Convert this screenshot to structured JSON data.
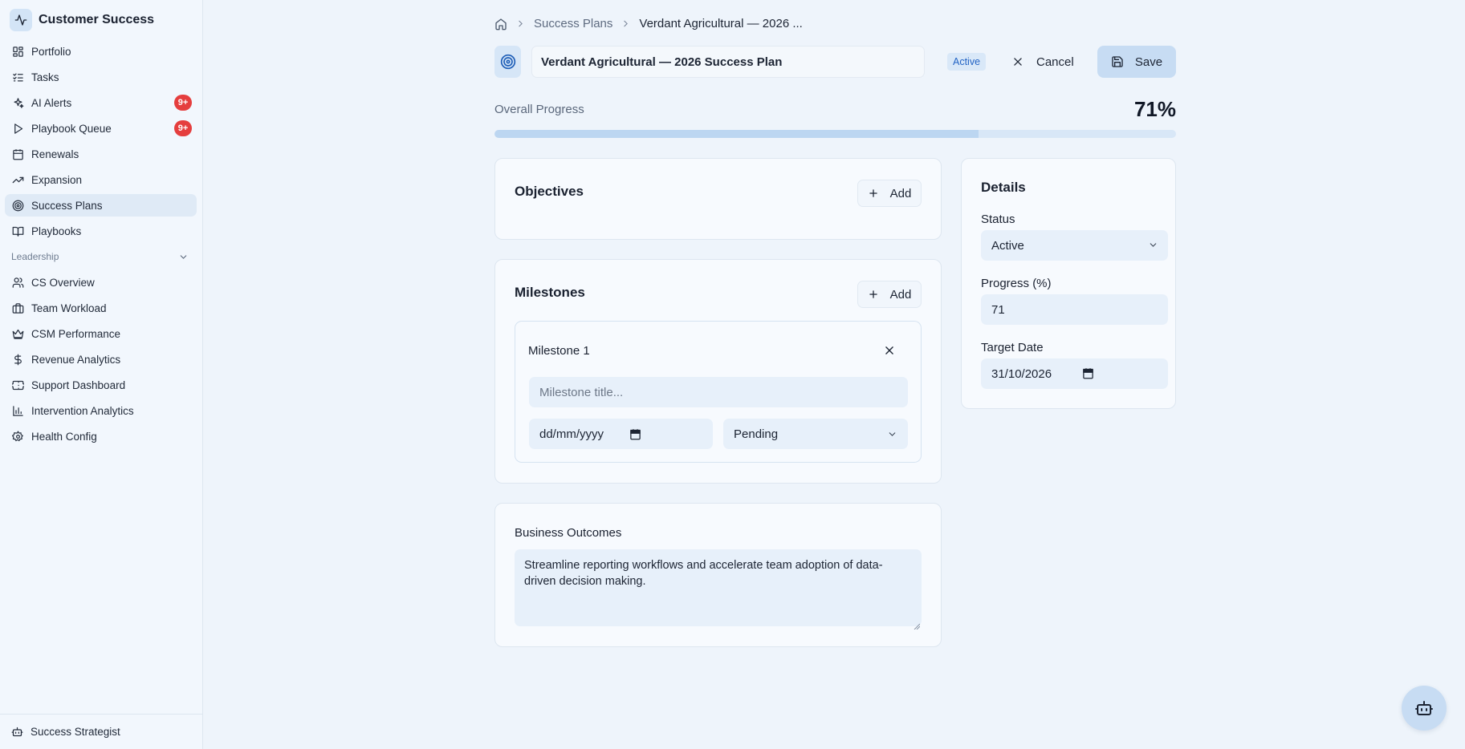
{
  "brand": {
    "title": "Customer Success",
    "icon": "activity-icon"
  },
  "sidebar": {
    "items": [
      {
        "label": "Portfolio",
        "icon": "grid-icon"
      },
      {
        "label": "Tasks",
        "icon": "list-checks-icon"
      },
      {
        "label": "AI Alerts",
        "icon": "sparkles-icon",
        "badge": "9+"
      },
      {
        "label": "Playbook Queue",
        "icon": "play-icon",
        "badge": "9+"
      },
      {
        "label": "Renewals",
        "icon": "calendar-icon"
      },
      {
        "label": "Expansion",
        "icon": "trending-up-icon"
      },
      {
        "label": "Success Plans",
        "icon": "target-icon",
        "active": true
      },
      {
        "label": "Playbooks",
        "icon": "book-open-icon"
      }
    ],
    "section_label": "Leadership",
    "leadership_items": [
      {
        "label": "CS Overview",
        "icon": "users-icon"
      },
      {
        "label": "Team Workload",
        "icon": "briefcase-icon"
      },
      {
        "label": "CSM Performance",
        "icon": "crown-icon"
      },
      {
        "label": "Revenue Analytics",
        "icon": "dollar-icon"
      },
      {
        "label": "Support Dashboard",
        "icon": "ticket-icon"
      },
      {
        "label": "Intervention Analytics",
        "icon": "bar-chart-icon"
      },
      {
        "label": "Health Config",
        "icon": "gear-icon"
      }
    ],
    "footer_label": "Success Strategist"
  },
  "breadcrumb": {
    "parent": "Success Plans",
    "current": "Verdant Agricultural — 2026 ..."
  },
  "header": {
    "title_value": "Verdant Agricultural — 2026 Success Plan",
    "status": "Active",
    "cancel_label": "Cancel",
    "save_label": "Save"
  },
  "progress": {
    "label": "Overall Progress",
    "value_text": "71%",
    "value": 71
  },
  "objectives": {
    "title": "Objectives",
    "add_label": "Add"
  },
  "milestones": {
    "title": "Milestones",
    "add_label": "Add",
    "items": [
      {
        "label": "Milestone 1",
        "title_placeholder": "Milestone title...",
        "date_placeholder": "dd/mm/yyyy",
        "status": "Pending"
      }
    ]
  },
  "business_outcomes": {
    "title": "Business Outcomes",
    "text": "Streamline reporting workflows and accelerate team adoption of data-driven decision making."
  },
  "details": {
    "title": "Details",
    "status_label": "Status",
    "status_value": "Active",
    "progress_label": "Progress (%)",
    "progress_value": "71",
    "target_label": "Target Date",
    "target_value": "31/10/2026"
  },
  "colors": {
    "accent": "#1f5fb8",
    "badge": "#e53e3e",
    "background": "#eef4fb"
  }
}
